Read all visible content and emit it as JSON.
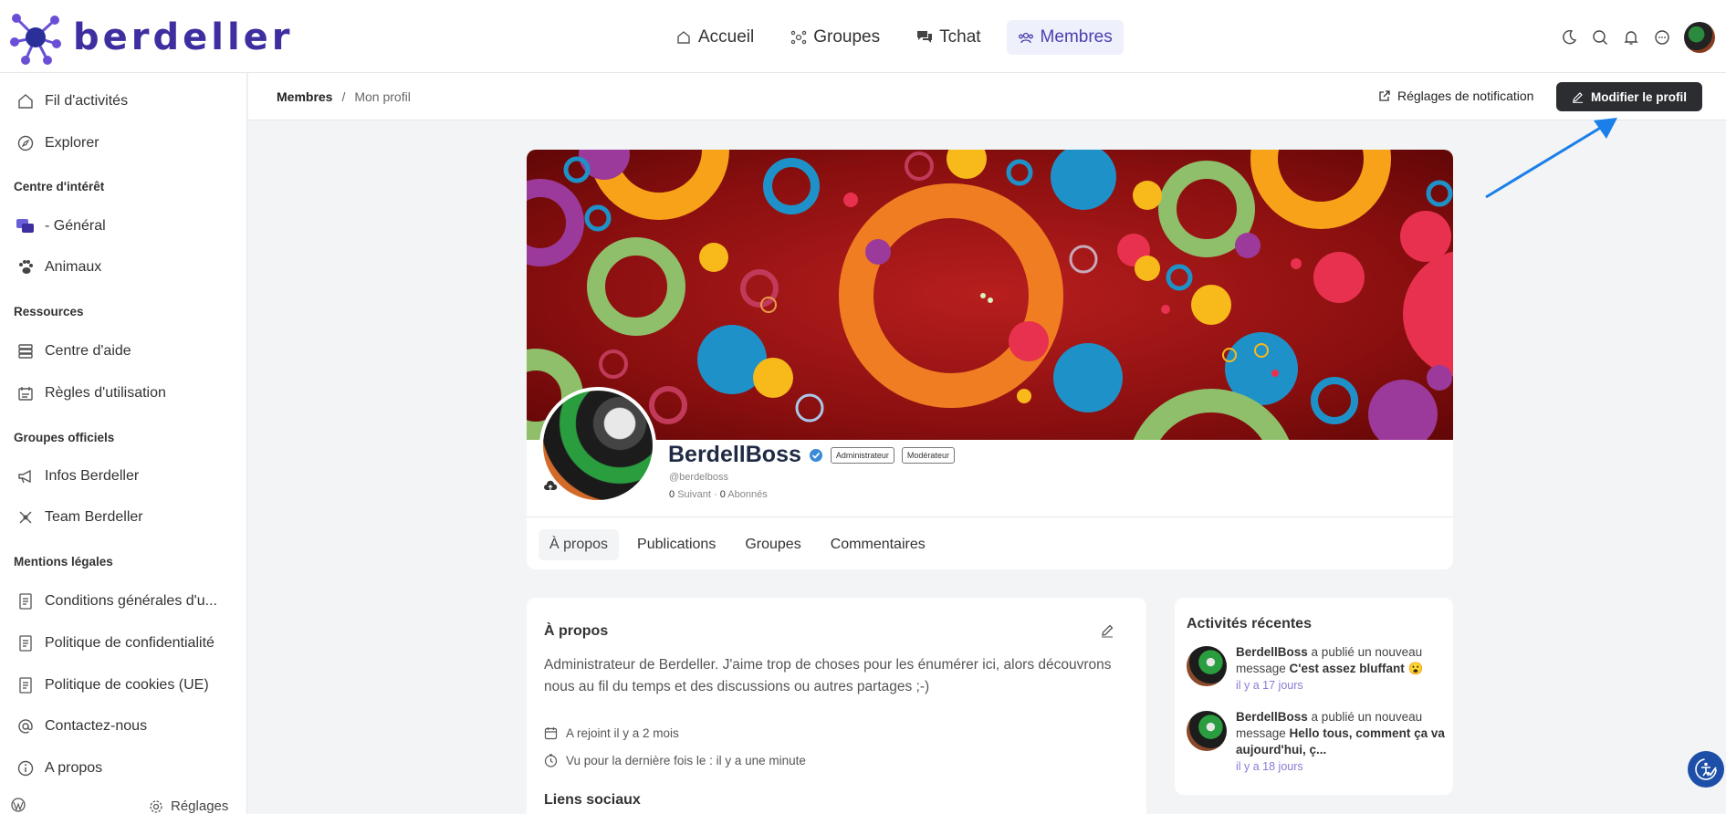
{
  "brand": {
    "name": "berdeller"
  },
  "topnav": [
    {
      "label": "Accueil",
      "icon": "home-icon"
    },
    {
      "label": "Groupes",
      "icon": "groups-icon"
    },
    {
      "label": "Tchat",
      "icon": "chat-icon"
    },
    {
      "label": "Membres",
      "icon": "members-icon",
      "active": true
    }
  ],
  "topbar_icons": [
    "moon-icon",
    "search-icon",
    "bell-icon",
    "messages-icon",
    "user-avatar"
  ],
  "sidebar": {
    "items_top": [
      {
        "label": "Fil d'activités",
        "icon": "home-icon"
      },
      {
        "label": "Explorer",
        "icon": "compass-icon"
      }
    ],
    "sections": [
      {
        "title": "Centre d'intérêt",
        "items": [
          {
            "label": "- Général",
            "icon": "chat-bubbles-icon"
          },
          {
            "label": "Animaux",
            "icon": "paw-icon"
          }
        ]
      },
      {
        "title": "Ressources",
        "items": [
          {
            "label": "Centre d'aide",
            "icon": "layers-icon"
          },
          {
            "label": "Règles d'utilisation",
            "icon": "rules-icon"
          }
        ]
      },
      {
        "title": "Groupes officiels",
        "items": [
          {
            "label": "Infos Berdeller",
            "icon": "megaphone-icon"
          },
          {
            "label": "Team Berdeller",
            "icon": "team-icon"
          }
        ]
      },
      {
        "title": "Mentions légales",
        "items": [
          {
            "label": "Conditions générales d'u...",
            "icon": "document-icon"
          },
          {
            "label": "Politique de confidentialité",
            "icon": "document-icon"
          },
          {
            "label": "Politique de cookies (UE)",
            "icon": "document-icon"
          },
          {
            "label": "Contactez-nous",
            "icon": "at-icon"
          },
          {
            "label": "A propos",
            "icon": "info-icon"
          }
        ]
      }
    ],
    "footer": {
      "settings_label": "Réglages"
    }
  },
  "breadcrumb": {
    "parent": "Membres",
    "separator": "/",
    "current": "Mon profil"
  },
  "actions": {
    "notif_label": "Réglages de notification",
    "edit_label": "Modifier le profil"
  },
  "profile": {
    "name": "BerdellBoss",
    "badges": [
      "Administrateur",
      "Modérateur"
    ],
    "handle": "@berdelboss",
    "following_count": "0",
    "following_label": "Suivant",
    "follow_sep": "·",
    "followers_count": "0",
    "followers_label": "Abonnés",
    "tabs": [
      "À propos",
      "Publications",
      "Groupes",
      "Commentaires"
    ]
  },
  "about": {
    "title": "À propos",
    "text": "Administrateur de Berdeller. J'aime trop de choses pour les énumérer ici, alors découvrons nous au fil du temps et des discussions ou autres partages ;-)",
    "joined": "A rejoint il y a 2 mois",
    "last_seen": "Vu pour la dernière fois le : il y a une minute",
    "social_title": "Liens sociaux"
  },
  "activity": {
    "title": "Activités récentes",
    "items": [
      {
        "user": "BerdellBoss",
        "action": "a publié un nouveau message",
        "message": "C'est assez bluffant 😮",
        "time": "il y a 17 jours"
      },
      {
        "user": "BerdellBoss",
        "action": "a publié un nouveau message",
        "message": "Hello tous, comment ça va aujourd'hui, ç...",
        "time": "il y a 18 jours"
      }
    ]
  },
  "colors": {
    "brand": "#3d2fa0",
    "accent": "#4c3fb0",
    "button_dark": "#2b2d31",
    "arrow": "#1a7fe8"
  }
}
